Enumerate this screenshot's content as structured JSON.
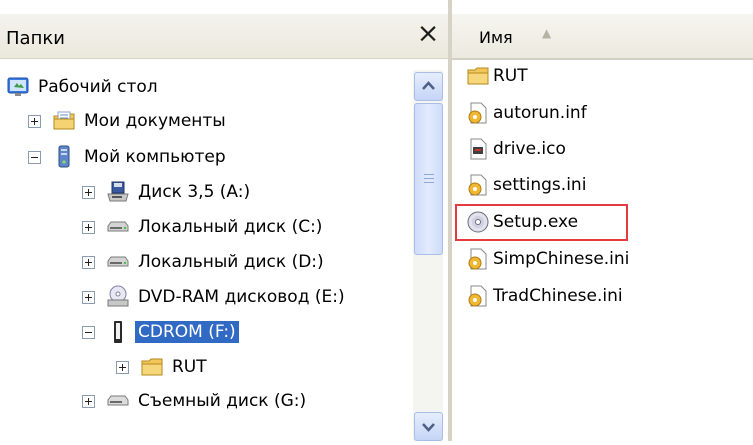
{
  "folders": {
    "title": "Папки",
    "close_glyph": "×",
    "tree": [
      {
        "label": "Рабочий стол",
        "icon": "desktop-icon"
      },
      {
        "label": "Мои документы",
        "icon": "documents-folder-icon",
        "expander": "plus"
      },
      {
        "label": "Мой компьютер",
        "icon": "computer-icon",
        "expander": "minus"
      },
      {
        "label": "Диск 3,5 (A:)",
        "icon": "floppy-drive-icon",
        "expander": "plus"
      },
      {
        "label": "Локальный диск (C:)",
        "icon": "hard-drive-icon",
        "expander": "plus"
      },
      {
        "label": "Локальный диск (D:)",
        "icon": "hard-drive-icon",
        "expander": "plus"
      },
      {
        "label": "DVD-RAM дисковод (E:)",
        "icon": "dvd-drive-icon",
        "expander": "plus"
      },
      {
        "label": "CDROM (F:)",
        "icon": "cdrom-drive-icon",
        "expander": "minus",
        "selected": true
      },
      {
        "label": "RUT",
        "icon": "folder-icon",
        "expander": "plus"
      },
      {
        "label": "Съемный диск (G:)",
        "icon": "removable-drive-icon",
        "expander": "plus"
      }
    ]
  },
  "files": {
    "column_name": "Имя",
    "sort_glyph": "▲",
    "items": [
      {
        "label": "RUT",
        "icon": "folder-icon"
      },
      {
        "label": "autorun.inf",
        "icon": "settings-file-icon"
      },
      {
        "label": "drive.ico",
        "icon": "image-file-icon"
      },
      {
        "label": "settings.ini",
        "icon": "settings-file-icon"
      },
      {
        "label": "Setup.exe",
        "icon": "cd-exe-icon",
        "highlighted": true
      },
      {
        "label": "SimpChinese.ini",
        "icon": "settings-file-icon"
      },
      {
        "label": "TradChinese.ini",
        "icon": "settings-file-icon"
      }
    ]
  },
  "colors": {
    "selection": "#316ac5",
    "highlight_border": "#e63b40",
    "header_bg": "#ebe9dc"
  }
}
